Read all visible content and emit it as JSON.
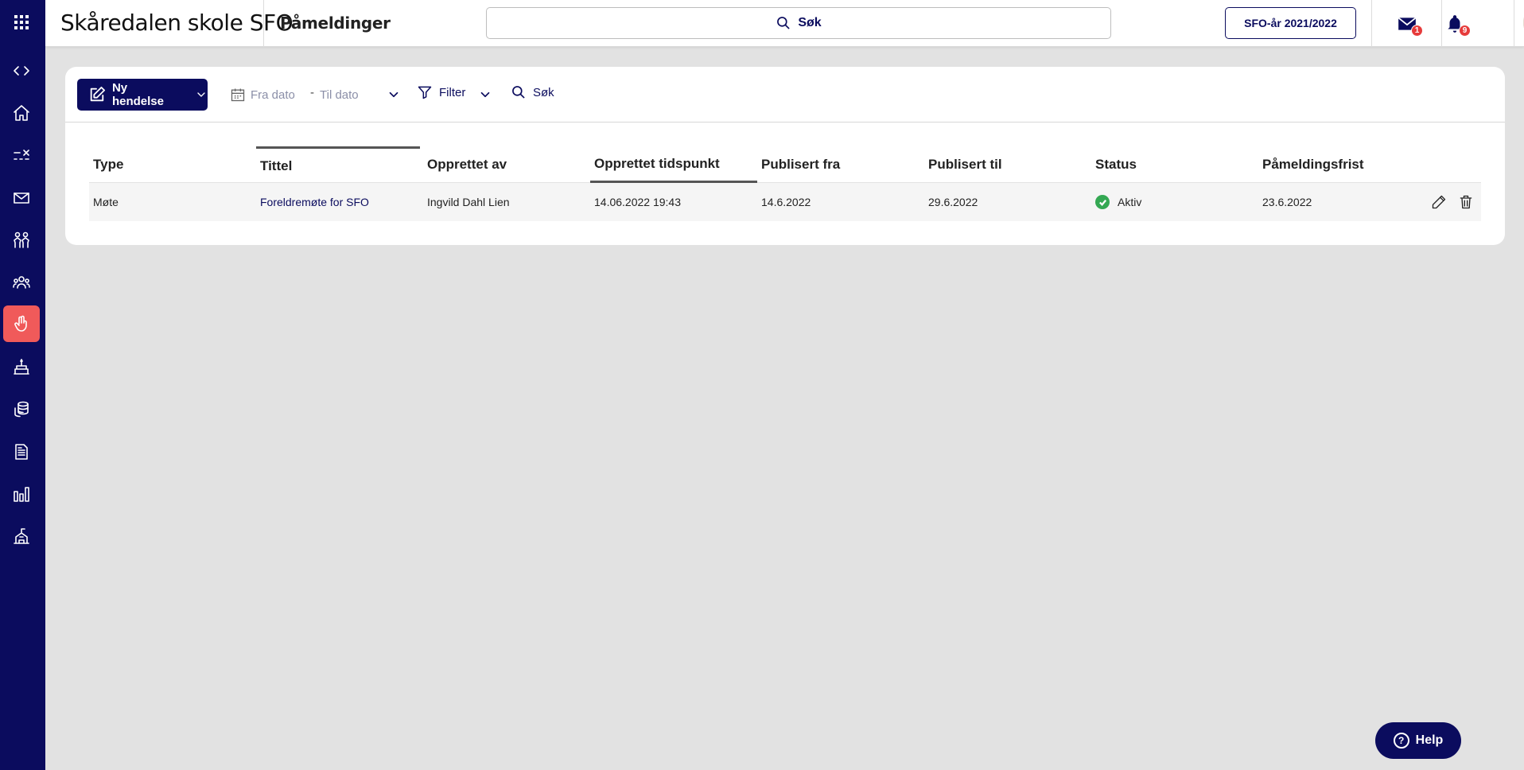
{
  "header": {
    "org_name": "Skåredalen skole SFO",
    "page_title": "Påmeldinger",
    "search_label": "Søk",
    "year_button": "SFO-år 2021/2022",
    "messages_badge": "1",
    "notifications_badge": "9"
  },
  "sidebar": {
    "items": [
      {
        "icon": "grid-icon"
      },
      {
        "icon": "expand-code-icon"
      },
      {
        "icon": "home-icon"
      },
      {
        "icon": "attendance-icon"
      },
      {
        "icon": "mail-icon"
      },
      {
        "icon": "children-icon"
      },
      {
        "icon": "groups-icon"
      },
      {
        "icon": "raised-hand-icon",
        "active": true
      },
      {
        "icon": "cake-icon"
      },
      {
        "icon": "coins-icon"
      },
      {
        "icon": "document-icon"
      },
      {
        "icon": "bar-chart-icon"
      },
      {
        "icon": "school-icon"
      }
    ],
    "active_color": "#f05a5a",
    "background": "#0b0c5e"
  },
  "toolbar": {
    "new_event_label": "Ny hendelse",
    "from_date_placeholder": "Fra dato",
    "to_date_placeholder": "Til dato",
    "filter_label": "Filter",
    "search_label": "Søk"
  },
  "table": {
    "columns": [
      "Type",
      "Tittel",
      "Opprettet av",
      "Opprettet tidspunkt",
      "Publisert fra",
      "Publisert til",
      "Status",
      "Påmeldingsfrist"
    ],
    "rows": [
      {
        "type": "Møte",
        "title": "Foreldremøte for SFO",
        "created_by": "Ingvild Dahl Lien",
        "created_at": "14.06.2022 19:43",
        "published_from": "14.6.2022",
        "published_to": "29.6.2022",
        "status": "Aktiv",
        "deadline": "23.6.2022"
      }
    ]
  },
  "help": {
    "label": "Help"
  },
  "colors": {
    "brand": "#0b0c5e",
    "status_active": "#34a853",
    "badge": "#e63b3b"
  }
}
